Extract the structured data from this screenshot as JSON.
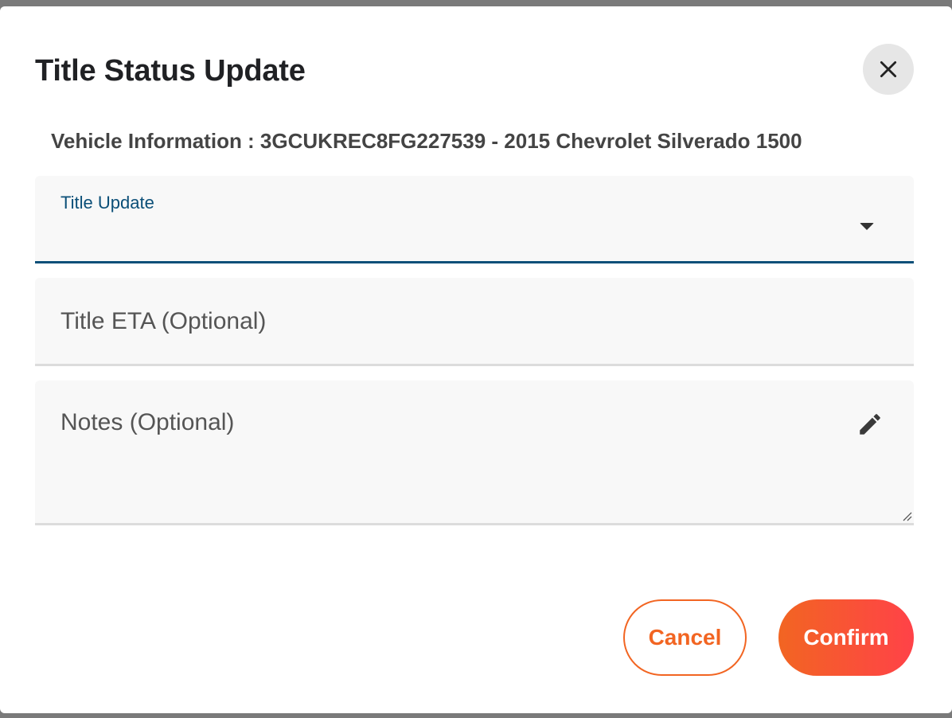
{
  "dialog": {
    "title": "Title Status Update",
    "close_icon": "close-icon",
    "vehicle_info": "Vehicle Information : 3GCUKREC8FG227539 - 2015 Chevrolet Silverado 1500"
  },
  "form": {
    "title_update": {
      "label": "Title Update",
      "value": "",
      "icon": "arrow-drop-down-icon"
    },
    "title_eta": {
      "placeholder": "Title ETA (Optional)",
      "value": ""
    },
    "notes": {
      "placeholder": "Notes (Optional)",
      "value": "",
      "icon": "edit-pencil-icon"
    }
  },
  "actions": {
    "cancel_label": "Cancel",
    "confirm_label": "Confirm"
  },
  "colors": {
    "accent": "#f26522",
    "accent_end": "#ff4248",
    "focus": "#0b4f78"
  }
}
